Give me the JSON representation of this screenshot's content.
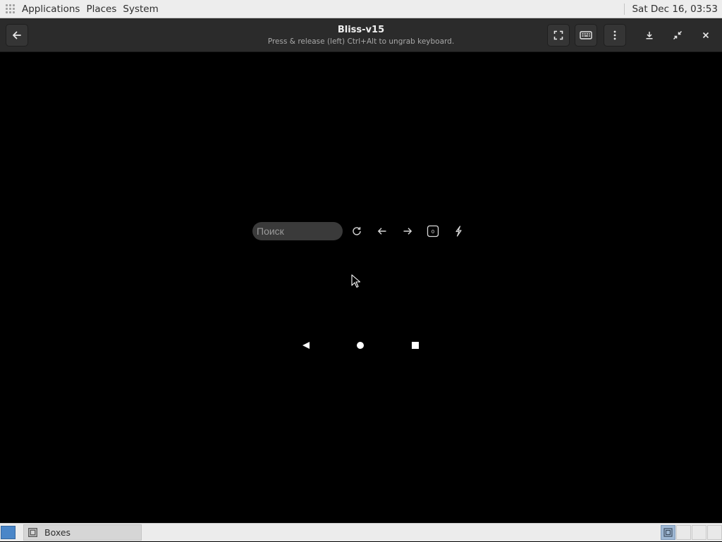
{
  "top_panel": {
    "menu": [
      "Applications",
      "Places",
      "System"
    ],
    "clock": "Sat Dec 16, 03:53",
    "icons": {
      "apps": "apps-grid-icon"
    }
  },
  "header": {
    "title": "Bliss-v15",
    "subtitle": "Press & release (left) Ctrl+Alt to ungrab keyboard.",
    "buttons": [
      "back-icon",
      "fullscreen-icon",
      "keyboard-icon",
      "menu-kebab-icon",
      "download-icon",
      "unfullscreen-icon",
      "close-icon"
    ]
  },
  "vm": {
    "search_placeholder": "Поиск",
    "toolbar_icons": [
      "refresh-icon",
      "arrow-left-icon",
      "arrow-right-icon",
      "tabs-counter-icon",
      "lightning-icon"
    ],
    "tabs_count": "0",
    "nav_keys": [
      "android-back-icon",
      "android-home-icon",
      "android-recents-icon"
    ]
  },
  "taskbar": {
    "window_label": "Boxes",
    "icons": {
      "show_desktop": "show-desktop-icon",
      "task": "boxes-app-icon"
    }
  },
  "colors": {
    "panel_bg": "#ededed",
    "header_bg": "#2b2b2b",
    "vm_bg": "#000000",
    "search_bg": "#3a3a3a",
    "accent": "#4a86c8"
  }
}
